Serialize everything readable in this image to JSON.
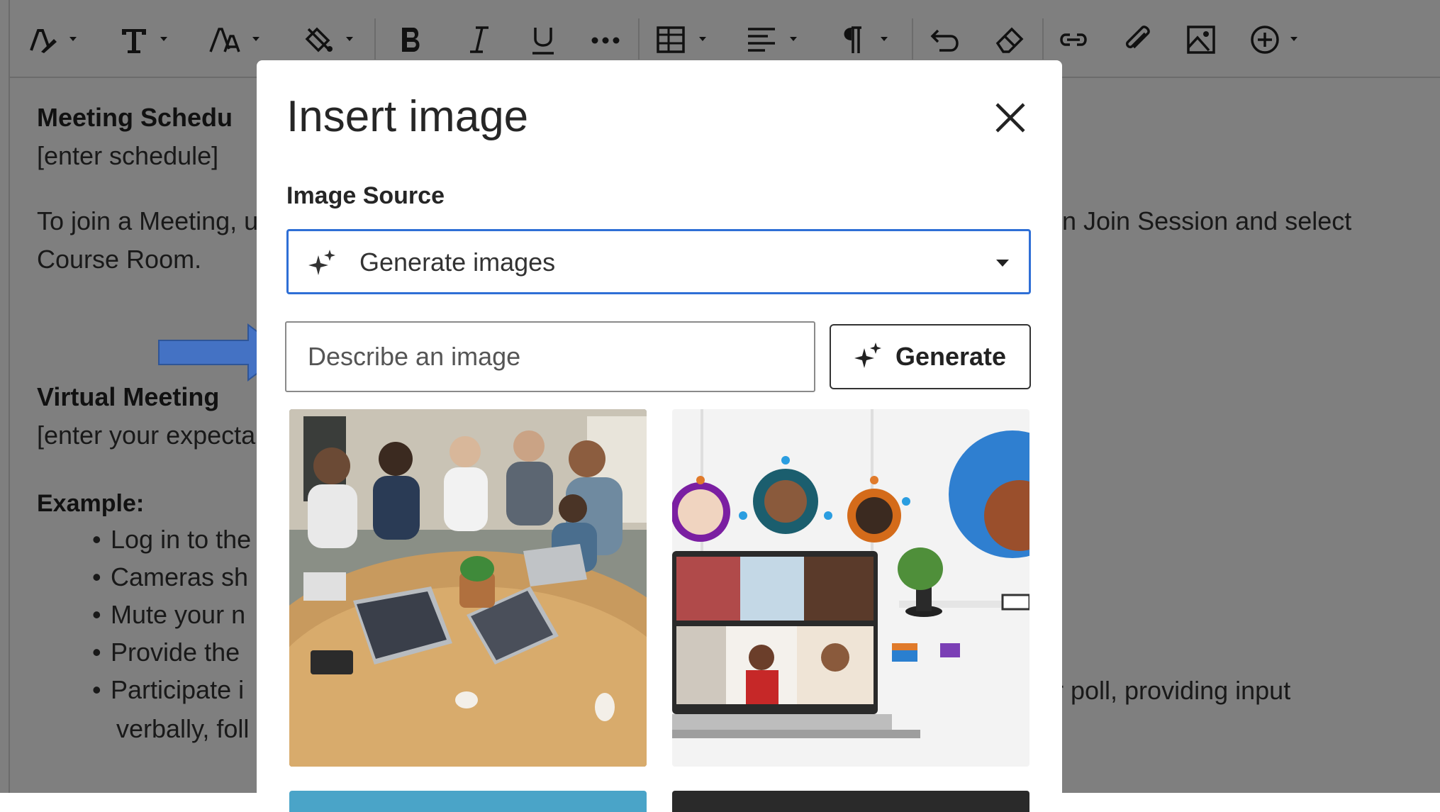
{
  "toolbar": {
    "buttons": [
      {
        "name": "text-style",
        "icon": "pen-a-icon"
      },
      {
        "name": "font",
        "icon": "text-t-icon"
      },
      {
        "name": "font-size",
        "icon": "font-size-icon"
      },
      {
        "name": "text-color",
        "icon": "paint-bucket-icon"
      },
      {
        "name": "bold",
        "icon": "bold-icon"
      },
      {
        "name": "italic",
        "icon": "italic-icon"
      },
      {
        "name": "underline",
        "icon": "underline-icon"
      },
      {
        "name": "more",
        "icon": "ellipsis-icon"
      },
      {
        "name": "table",
        "icon": "table-icon"
      },
      {
        "name": "align",
        "icon": "align-left-icon"
      },
      {
        "name": "paragraph",
        "icon": "pilcrow-icon"
      },
      {
        "name": "undo",
        "icon": "undo-icon"
      },
      {
        "name": "clear-format",
        "icon": "eraser-icon"
      },
      {
        "name": "link",
        "icon": "link-icon"
      },
      {
        "name": "attach",
        "icon": "paperclip-icon"
      },
      {
        "name": "insert-image",
        "icon": "image-icon"
      },
      {
        "name": "insert-content",
        "icon": "plus-circle-icon"
      }
    ]
  },
  "document": {
    "heading1": "Meeting Schedu",
    "schedule_placeholder": "[enter schedule]",
    "join_left_line1": "To join a Meeting, u",
    "join_right_line1": "n Join Session and select",
    "join_line2": "Course Room.",
    "heading2": "Virtual Meeting",
    "expectations": "[enter your expecta",
    "example_label": "Example:",
    "bullets": [
      "Log in to the",
      "Cameras sh",
      "Mute your n",
      "Provide the",
      "Participate i"
    ],
    "bullet5_right": "r poll, providing input",
    "bullet5_line2": "verbally, foll"
  },
  "modal": {
    "title": "Insert image",
    "source_label": "Image Source",
    "source_value": "Generate images",
    "describe_placeholder": "Describe an image",
    "generate_label": "Generate"
  },
  "colors": {
    "accent": "#2f6fd6",
    "arrow": "#4472c4",
    "overlay": "rgba(0,0,0,0.5)"
  }
}
